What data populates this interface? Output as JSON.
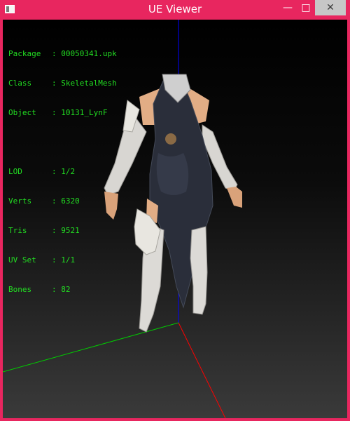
{
  "window": {
    "title": "UE Viewer",
    "min_label": "—",
    "max_label": "□",
    "close_label": "✕"
  },
  "info": {
    "package_label": "Package",
    "package_value": "00050341.upk",
    "class_label": "Class",
    "class_value": "SkeletalMesh",
    "object_label": "Object",
    "object_value": "10131_LynF",
    "lod_label": "LOD",
    "lod_value": "1/2",
    "verts_label": "Verts",
    "verts_value": "6320",
    "tris_label": "Tris",
    "tris_value": "9521",
    "uvset_label": "UV Set",
    "uvset_value": "1/1",
    "bones_label": "Bones",
    "bones_value": "82"
  },
  "colors": {
    "titlebar": "#e8265f",
    "info_text": "#22dd22",
    "axis_x": "#ff0000",
    "axis_y": "#00cc00",
    "axis_z": "#0000ff"
  }
}
